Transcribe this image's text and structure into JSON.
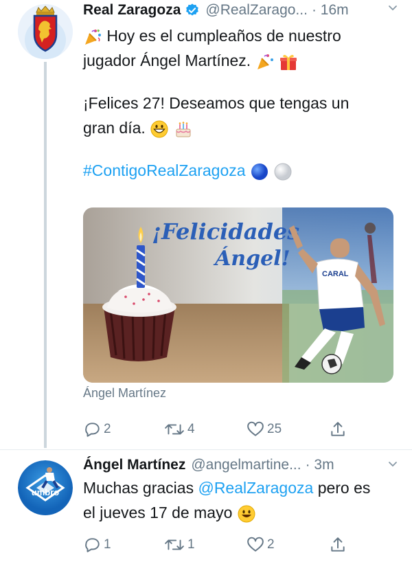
{
  "tweets": [
    {
      "author_name": "Real Zaragoza",
      "author_handle": "@RealZarago...",
      "time": "· 16m",
      "text_line1": "Hoy es el cumpleaños de nuestro",
      "text_line2": "jugador Ángel Martínez.",
      "text_line3": "¡Felices 27! Deseamos que tengas un",
      "text_line4": "gran día.",
      "hashtag": "#ContigoRealZaragoza",
      "media": {
        "headline_line1": "¡Felicidades",
        "headline_line2": "Ángel!",
        "shirt_text": "CARAL"
      },
      "media_caption": "Ángel Martínez",
      "replies": "2",
      "retweets": "4",
      "likes": "25"
    },
    {
      "author_name": "Ángel Martínez",
      "author_handle": "@angelmartine...",
      "time": "· 3m",
      "text_part1": "Muchas gracias",
      "mention": "@RealZaragoza",
      "text_part2": "pero es",
      "text_line2": "el jueves 17 de mayo",
      "avatar_text": "umbro",
      "replies": "1",
      "retweets": "1",
      "likes": "2"
    }
  ],
  "icons": {
    "verified": "verified-badge-icon",
    "chevron": "chevron-down-icon",
    "reply": "reply-icon",
    "retweet": "retweet-icon",
    "like": "heart-icon",
    "share": "share-icon"
  },
  "colors": {
    "link": "#1da1f2",
    "muted": "#657786",
    "thread_line": "#ccd6dd",
    "club_red": "#d42121"
  }
}
